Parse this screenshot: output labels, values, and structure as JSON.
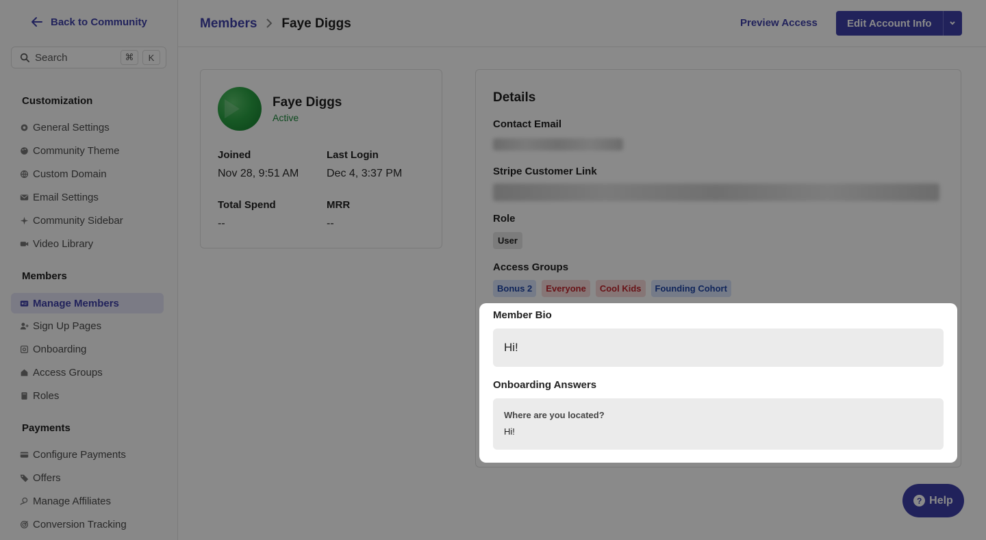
{
  "sidebar": {
    "back_label": "Back to Community",
    "search": {
      "label": "Search",
      "kbd1": "⌘",
      "kbd2": "K"
    },
    "sections": {
      "customization": "Customization",
      "members": "Members",
      "payments": "Payments"
    },
    "customization_items": [
      {
        "label": "General Settings",
        "icon": "gear-icon"
      },
      {
        "label": "Community Theme",
        "icon": "palette-icon"
      },
      {
        "label": "Custom Domain",
        "icon": "globe-icon"
      },
      {
        "label": "Email Settings",
        "icon": "mail-icon"
      },
      {
        "label": "Community Sidebar",
        "icon": "sparkle-icon"
      },
      {
        "label": "Video Library",
        "icon": "video-icon"
      }
    ],
    "members_items": [
      {
        "label": "Manage Members",
        "icon": "id-card-icon",
        "active": true
      },
      {
        "label": "Sign Up Pages",
        "icon": "user-plus-icon"
      },
      {
        "label": "Onboarding",
        "icon": "onboarding-icon"
      },
      {
        "label": "Access Groups",
        "icon": "lock-group-icon"
      },
      {
        "label": "Roles",
        "icon": "book-icon"
      }
    ],
    "payments_items": [
      {
        "label": "Configure Payments",
        "icon": "credit-card-icon"
      },
      {
        "label": "Offers",
        "icon": "tag-icon"
      },
      {
        "label": "Manage Affiliates",
        "icon": "handshake-icon"
      },
      {
        "label": "Conversion Tracking",
        "icon": "target-icon"
      }
    ]
  },
  "header": {
    "breadcrumb_parent": "Members",
    "breadcrumb_current": "Faye Diggs",
    "preview_access": "Preview Access",
    "edit_account": "Edit Account Info"
  },
  "profile": {
    "name": "Faye Diggs",
    "status": "Active",
    "joined_label": "Joined",
    "joined_value": "Nov 28, 9:51 AM",
    "last_login_label": "Last Login",
    "last_login_value": "Dec 4, 3:37 PM",
    "total_spend_label": "Total Spend",
    "total_spend_value": "--",
    "mrr_label": "MRR",
    "mrr_value": "--"
  },
  "details": {
    "title": "Details",
    "contact_email_label": "Contact Email",
    "stripe_label": "Stripe Customer Link",
    "role_label": "Role",
    "role_value": "User",
    "access_groups_label": "Access Groups",
    "access_groups": [
      {
        "label": "Bonus 2",
        "color": "#1f45a6"
      },
      {
        "label": "Everyone",
        "color": "#c0242b"
      },
      {
        "label": "Cool Kids",
        "color": "#c0242b"
      },
      {
        "label": "Founding Cohort",
        "color": "#1f45a6"
      }
    ],
    "member_bio_label": "Member Bio",
    "member_bio_value": "Hi!",
    "onboarding_label": "Onboarding Answers",
    "onboarding_question": "Where are you located?",
    "onboarding_answer": "Hi!"
  },
  "help": {
    "label": "Help"
  },
  "colors": {
    "accent": "#3d3fa8",
    "active_green": "#1c8a3b"
  }
}
